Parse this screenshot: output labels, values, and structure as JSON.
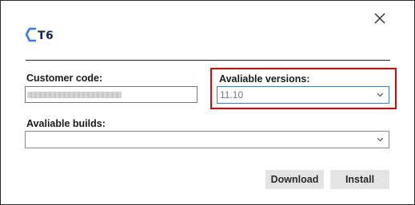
{
  "logo": {
    "text": "T6",
    "color": "#3a7bd5"
  },
  "customer": {
    "label": "Customer code:",
    "value": ""
  },
  "versions": {
    "label": "Avaliable versions:",
    "selected": "11.10",
    "highlight_color": "#e00000"
  },
  "builds": {
    "label": "Avaliable builds:",
    "selected": ""
  },
  "buttons": {
    "download": "Download",
    "install": "Install"
  },
  "icons": {
    "close": "close-icon",
    "dropdown": "chevron-down-icon"
  }
}
